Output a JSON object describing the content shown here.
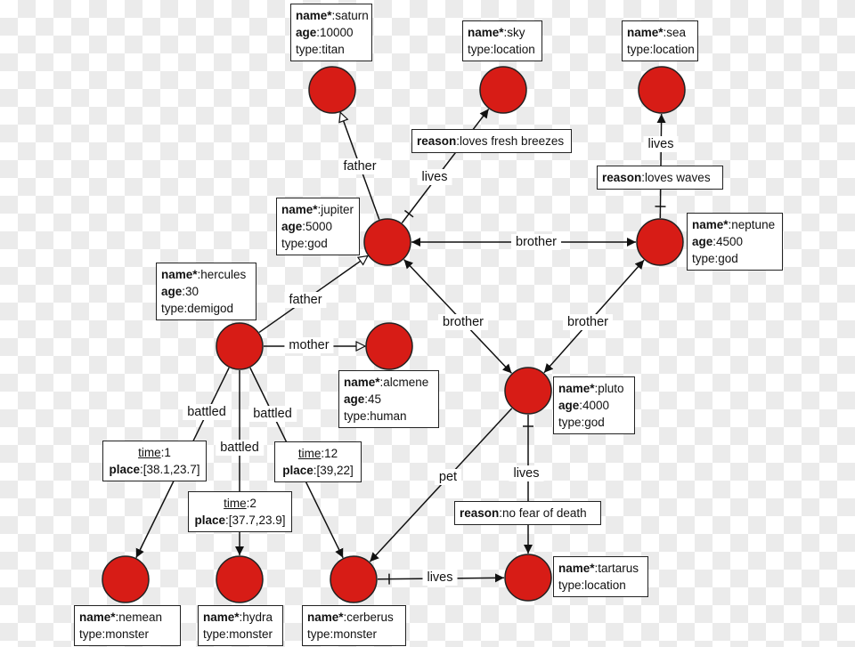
{
  "colors": {
    "node_fill": "#d71c16",
    "node_stroke": "#222222",
    "edge": "#111111"
  },
  "nodes": [
    {
      "id": "saturn",
      "props": [
        {
          "k": "name*",
          "v": "saturn",
          "style": "bold"
        },
        {
          "k": "age",
          "v": "10000",
          "style": "bold"
        },
        {
          "k": "type",
          "v": "titan",
          "style": "plain"
        }
      ]
    },
    {
      "id": "sky",
      "props": [
        {
          "k": "name*",
          "v": "sky",
          "style": "bold"
        },
        {
          "k": "type",
          "v": "location",
          "style": "plain"
        }
      ]
    },
    {
      "id": "sea",
      "props": [
        {
          "k": "name*",
          "v": "sea",
          "style": "bold"
        },
        {
          "k": "type",
          "v": "location",
          "style": "plain"
        }
      ]
    },
    {
      "id": "jupiter",
      "props": [
        {
          "k": "name*",
          "v": "jupiter",
          "style": "bold"
        },
        {
          "k": "age",
          "v": "5000",
          "style": "bold"
        },
        {
          "k": "type",
          "v": "god",
          "style": "plain"
        }
      ]
    },
    {
      "id": "neptune",
      "props": [
        {
          "k": "name*",
          "v": "neptune",
          "style": "bold"
        },
        {
          "k": "age",
          "v": "4500",
          "style": "bold"
        },
        {
          "k": "type",
          "v": "god",
          "style": "plain"
        }
      ]
    },
    {
      "id": "hercules",
      "props": [
        {
          "k": "name*",
          "v": "hercules",
          "style": "bold"
        },
        {
          "k": "age",
          "v": "30",
          "style": "bold"
        },
        {
          "k": "type",
          "v": "demigod",
          "style": "plain"
        }
      ]
    },
    {
      "id": "alcmene",
      "props": [
        {
          "k": "name*",
          "v": "alcmene",
          "style": "bold"
        },
        {
          "k": "age",
          "v": "45",
          "style": "bold"
        },
        {
          "k": "type",
          "v": "human",
          "style": "plain"
        }
      ]
    },
    {
      "id": "pluto",
      "props": [
        {
          "k": "name*",
          "v": "pluto",
          "style": "bold"
        },
        {
          "k": "age",
          "v": "4000",
          "style": "bold"
        },
        {
          "k": "type",
          "v": "god",
          "style": "plain"
        }
      ]
    },
    {
      "id": "nemean",
      "props": [
        {
          "k": "name*",
          "v": "nemean",
          "style": "bold"
        },
        {
          "k": "type",
          "v": "monster",
          "style": "plain"
        }
      ]
    },
    {
      "id": "hydra",
      "props": [
        {
          "k": "name*",
          "v": "hydra",
          "style": "bold"
        },
        {
          "k": "type",
          "v": "monster",
          "style": "plain"
        }
      ]
    },
    {
      "id": "cerberus",
      "props": [
        {
          "k": "name*",
          "v": "cerberus",
          "style": "bold"
        },
        {
          "k": "type",
          "v": "monster",
          "style": "plain"
        }
      ]
    },
    {
      "id": "tartarus",
      "props": [
        {
          "k": "name*",
          "v": "tartarus",
          "style": "bold"
        },
        {
          "k": "type",
          "v": "location",
          "style": "plain"
        }
      ]
    }
  ],
  "edges": [
    {
      "id": "e1",
      "source": "jupiter",
      "target": "saturn",
      "label": "father",
      "head": "hollow",
      "props": []
    },
    {
      "id": "e2",
      "source": "jupiter",
      "target": "sky",
      "label": "lives",
      "head": "filled",
      "tail": "bar",
      "props": [
        {
          "k": "reason",
          "v": "loves fresh breezes",
          "style": "bold"
        }
      ]
    },
    {
      "id": "e3",
      "source": "jupiter",
      "target": "neptune",
      "label": "brother",
      "head": "filled",
      "tail_arrow": true,
      "props": []
    },
    {
      "id": "e4",
      "source": "neptune",
      "target": "sea",
      "label": "lives",
      "head": "filled",
      "tail": "bar",
      "props": [
        {
          "k": "reason",
          "v": "loves waves",
          "style": "bold"
        }
      ]
    },
    {
      "id": "e5",
      "source": "hercules",
      "target": "jupiter",
      "label": "father",
      "head": "hollow",
      "props": []
    },
    {
      "id": "e6",
      "source": "hercules",
      "target": "alcmene",
      "label": "mother",
      "head": "hollow",
      "props": []
    },
    {
      "id": "e7",
      "source": "pluto",
      "target": "jupiter",
      "label": "brother",
      "head": "filled",
      "tail_arrow": true,
      "props": []
    },
    {
      "id": "e8",
      "source": "pluto",
      "target": "neptune",
      "label": "brother",
      "head": "filled",
      "tail_arrow": true,
      "props": []
    },
    {
      "id": "e9",
      "source": "hercules",
      "target": "nemean",
      "label": "battled",
      "head": "filled",
      "props": [
        {
          "k": "time",
          "v": "1",
          "style": "under"
        },
        {
          "k": "place",
          "v": "[38.1,23.7]",
          "style": "bold"
        }
      ]
    },
    {
      "id": "e10",
      "source": "hercules",
      "target": "hydra",
      "label": "battled",
      "head": "filled",
      "props": [
        {
          "k": "time",
          "v": "2",
          "style": "under"
        },
        {
          "k": "place",
          "v": "[37.7,23.9]",
          "style": "bold"
        }
      ]
    },
    {
      "id": "e11",
      "source": "hercules",
      "target": "cerberus",
      "label": "battled",
      "head": "filled",
      "props": [
        {
          "k": "time",
          "v": "12",
          "style": "under"
        },
        {
          "k": "place",
          "v": "[39,22]",
          "style": "bold"
        }
      ]
    },
    {
      "id": "e12",
      "source": "pluto",
      "target": "cerberus",
      "label": "pet",
      "head": "filled",
      "props": []
    },
    {
      "id": "e13",
      "source": "pluto",
      "target": "tartarus",
      "label": "lives",
      "head": "filled",
      "tail": "bar",
      "props": [
        {
          "k": "reason",
          "v": "no fear of death",
          "style": "bold"
        }
      ]
    },
    {
      "id": "e14",
      "source": "cerberus",
      "target": "tartarus",
      "label": "lives",
      "head": "filled",
      "tail": "bar",
      "props": []
    }
  ]
}
